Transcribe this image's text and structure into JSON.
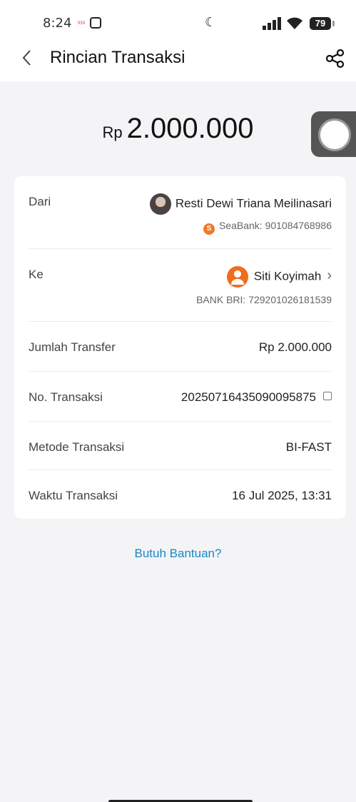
{
  "status_bar": {
    "time": "8:24",
    "badge": "ios",
    "battery": "79"
  },
  "header": {
    "title": "Rincian Transaksi"
  },
  "amount": {
    "currency": "Rp",
    "value": "2.000.000"
  },
  "details": {
    "from": {
      "label": "Dari",
      "name": "Resti Dewi Triana Meilinasari",
      "account": "SeaBank: 901084768986"
    },
    "to": {
      "label": "Ke",
      "name": "Siti Koyimah",
      "account": "BANK BRI: 729201026181539"
    },
    "transfer_amount": {
      "label": "Jumlah Transfer",
      "value": "Rp 2.000.000"
    },
    "transaction_no": {
      "label": "No. Transaksi",
      "value": "20250716435090095875"
    },
    "method": {
      "label": "Metode Transaksi",
      "value": "BI-FAST"
    },
    "time": {
      "label": "Waktu Transaksi",
      "value": "16 Jul 2025, 13:31"
    }
  },
  "help_link": "Butuh Bantuan?",
  "colors": {
    "accent": "#1688c9",
    "avatar_orange": "#f06c1e",
    "background": "#f4f4f6"
  }
}
